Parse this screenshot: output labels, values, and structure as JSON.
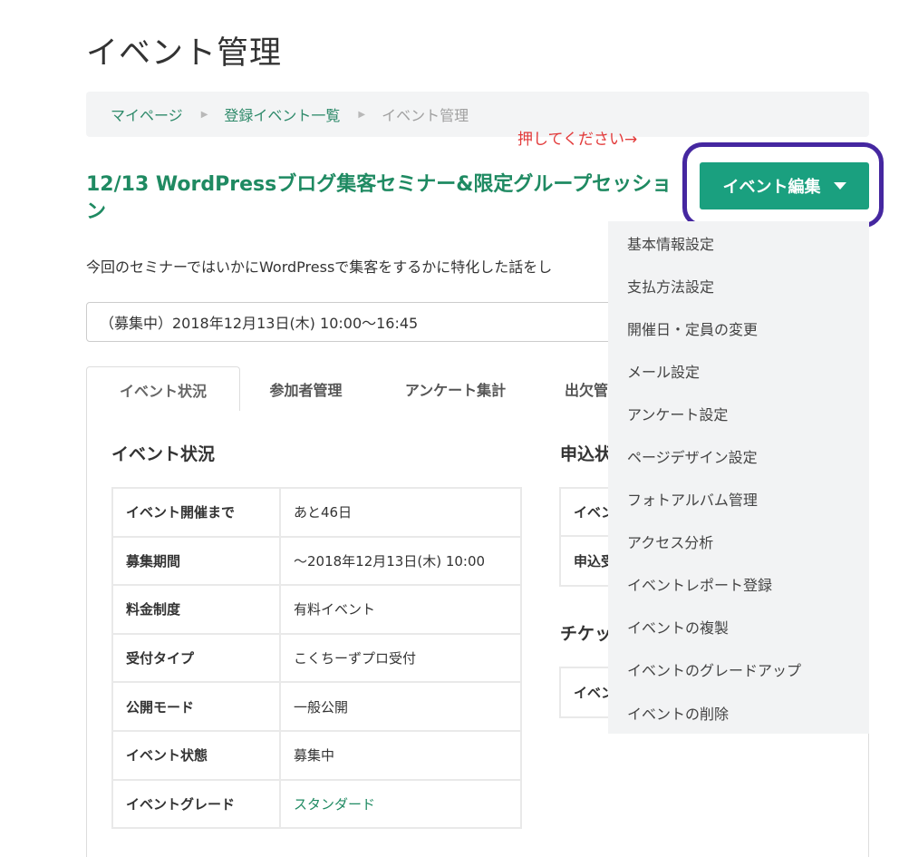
{
  "page": {
    "title": "イベント管理"
  },
  "breadcrumb": {
    "items": [
      {
        "label": "マイページ"
      },
      {
        "label": "登録イベント一覧"
      },
      {
        "label": "イベント管理"
      }
    ],
    "separator": "▶"
  },
  "annotation": {
    "text": "押してください→",
    "color": "#e23a3a"
  },
  "event": {
    "title": "12/13 WordPressブログ集客セミナー&限定グループセッション",
    "description": "今回のセミナーではいかにWordPressで集客をするかに特化した話をし",
    "date_selected": "（募集中）2018年12月13日(木) 10:00〜16:45"
  },
  "edit_button": {
    "label": "イベント編集",
    "color": "#1aa07f",
    "highlight_color": "#4527a0"
  },
  "tabs": [
    {
      "label": "イベント状況",
      "active": true
    },
    {
      "label": "参加者管理"
    },
    {
      "label": "アンケート集計"
    },
    {
      "label": "出欠管"
    }
  ],
  "status_section": {
    "heading": "イベント状況",
    "rows": [
      {
        "key": "イベント開催まで",
        "value": "あと46日"
      },
      {
        "key": "募集期間",
        "value": "〜2018年12月13日(木) 10:00"
      },
      {
        "key": "料金制度",
        "value": "有料イベント"
      },
      {
        "key": "受付タイプ",
        "value": "こくちーずプロ受付"
      },
      {
        "key": "公開モード",
        "value": "一般公開"
      },
      {
        "key": "イベント状態",
        "value": "募集中"
      },
      {
        "key": "イベントグレード",
        "value": "スタンダード"
      }
    ]
  },
  "side_sections": {
    "application_heading": "申込状",
    "application_rows": [
      "イベン",
      "申込受"
    ],
    "ticket_heading": "チケッ",
    "ticket_rows": [
      "イベン"
    ]
  },
  "dropdown": {
    "items": [
      "基本情報設定",
      "支払方法設定",
      "開催日・定員の変更",
      "メール設定",
      "アンケート設定",
      "ページデザイン設定",
      "フォトアルバム管理",
      "アクセス分析",
      "イベントレポート登録",
      "イベントの複製",
      "イベントのグレードアップ",
      "イベントの削除"
    ]
  }
}
